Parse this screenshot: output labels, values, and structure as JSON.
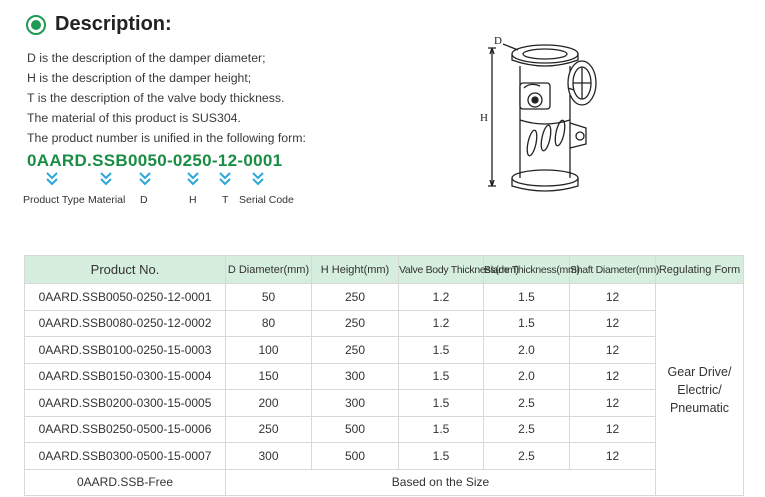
{
  "heading": {
    "title": "Description:"
  },
  "description_lines": [
    "D is the description of the damper diameter;",
    "H is the description of the damper height;",
    "T is the description of the valve body thickness.",
    "The material of this product is SUS304.",
    "The product number is unified in the following form:"
  ],
  "product_code": "0AARD.SSB0050-0250-12-0001",
  "code_labels": {
    "product_type": "Product Type",
    "material": "Material",
    "d": "D",
    "h": "H",
    "t": "T",
    "serial": "Serial Code"
  },
  "drawing": {
    "d_label": "D",
    "h_label": "H"
  },
  "table": {
    "headers": {
      "product_no": "Product No.",
      "d": "D Diameter(mm)",
      "h": "H Height(mm)",
      "valve": "Valve Body Thickness(mm)",
      "blade": "Blade Thickness(mm)",
      "shaft": "Shaft Diameter(mm)",
      "regulating": "Regulating Form"
    },
    "rows": [
      [
        "0AARD.SSB0050-0250-12-0001",
        "50",
        "250",
        "1.2",
        "1.5",
        "12"
      ],
      [
        "0AARD.SSB0080-0250-12-0002",
        "80",
        "250",
        "1.2",
        "1.5",
        "12"
      ],
      [
        "0AARD.SSB0100-0250-15-0003",
        "100",
        "250",
        "1.5",
        "2.0",
        "12"
      ],
      [
        "0AARD.SSB0150-0300-15-0004",
        "150",
        "300",
        "1.5",
        "2.0",
        "12"
      ],
      [
        "0AARD.SSB0200-0300-15-0005",
        "200",
        "300",
        "1.5",
        "2.5",
        "12"
      ],
      [
        "0AARD.SSB0250-0500-15-0006",
        "250",
        "500",
        "1.5",
        "2.5",
        "12"
      ],
      [
        "0AARD.SSB0300-0500-15-0007",
        "300",
        "500",
        "1.5",
        "2.5",
        "12"
      ]
    ],
    "regulating_lines": [
      "Gear Drive/",
      "Electric/",
      "Pneumatic"
    ],
    "free_row": {
      "product": "0AARD.SSB-Free",
      "note": "Based on the Size"
    }
  },
  "colors": {
    "accent": "#1f9a52",
    "code_text": "#1a8d45",
    "chevron": "#2aa7d8",
    "header_bg": "#d6eedd"
  }
}
